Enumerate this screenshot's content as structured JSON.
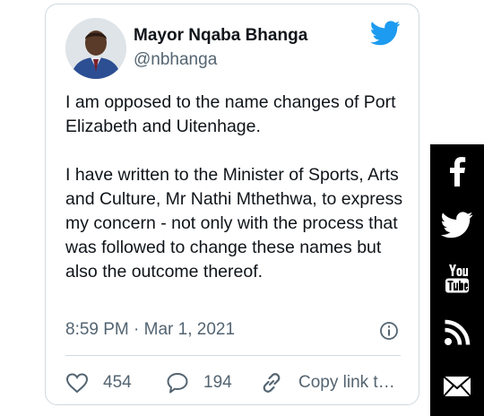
{
  "tweet": {
    "author_name": "Mayor Nqaba Bhanga",
    "author_handle": "@nbhanga",
    "paragraphs": [
      "I am opposed to the name changes of Port Elizabeth and Uitenhage.",
      "I have written to the Minister of Sports, Arts and Culture, Mr Nathi Mthethwa, to express my concern -  not only with the process that was followed to change these names but also the outcome thereof."
    ],
    "timestamp": "8:59 PM · Mar 1, 2021",
    "actions": {
      "likes": "454",
      "replies": "194",
      "copy_link": "Copy link t…"
    },
    "icons": {
      "brand": "twitter-bird-icon",
      "info": "info-icon",
      "like": "heart-icon",
      "reply": "speech-bubble-icon",
      "copy": "link-icon"
    }
  },
  "share_bar": {
    "items": [
      "facebook",
      "twitter",
      "youtube",
      "rss",
      "email"
    ]
  },
  "colors": {
    "twitter_blue": "#1d9bf0",
    "text_primary": "#0f1419",
    "text_secondary": "#536471",
    "border": "#cfd9de",
    "share_bar_bg": "#000000"
  }
}
